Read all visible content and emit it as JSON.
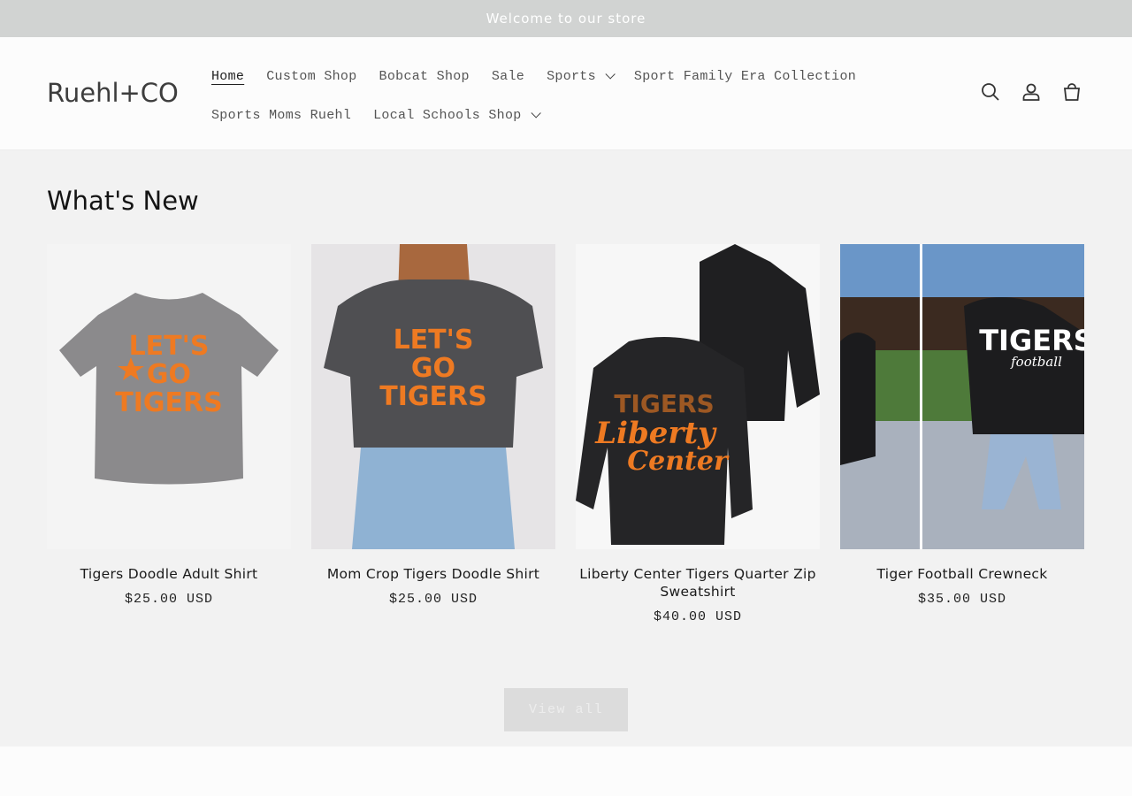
{
  "announcement": {
    "text": "Welcome to our store"
  },
  "header": {
    "logo": "Ruehl+CO",
    "nav_row1": [
      {
        "label": "Home",
        "dropdown": false
      },
      {
        "label": "Custom Shop",
        "dropdown": false
      },
      {
        "label": "Bobcat Shop",
        "dropdown": false
      },
      {
        "label": "Sale",
        "dropdown": false
      },
      {
        "label": "Sports",
        "dropdown": true
      },
      {
        "label": "Sport Family Era Collection",
        "dropdown": false
      }
    ],
    "nav_row2": [
      {
        "label": "Sports Moms Ruehl",
        "dropdown": false
      },
      {
        "label": "Local Schools Shop",
        "dropdown": true
      }
    ],
    "icons": [
      "search-icon",
      "account-icon",
      "cart-icon"
    ]
  },
  "collection": {
    "title": "What's New",
    "products": [
      {
        "title": "Tigers Doodle Adult Shirt",
        "price": "$25.00 USD",
        "image_text": [
          "LET'S",
          "GO",
          "TIGERS"
        ]
      },
      {
        "title": "Mom Crop Tigers Doodle Shirt",
        "price": "$25.00 USD",
        "image_text": [
          "LET'S",
          "GO",
          "TIGERS"
        ]
      },
      {
        "title": "Liberty Center Tigers Quarter Zip Sweatshirt",
        "price": "$40.00 USD",
        "image_text": [
          "TIGERS",
          "Liberty",
          "Center"
        ]
      },
      {
        "title": "Tiger Football Crewneck",
        "price": "$35.00 USD",
        "image_text": [
          "TIGERS",
          "football"
        ]
      }
    ],
    "view_all_label": "View all"
  },
  "colors": {
    "accent_orange": "#ee7a22",
    "announcement_bg": "#d1d3d2",
    "section_bg": "#f2f2f2"
  }
}
